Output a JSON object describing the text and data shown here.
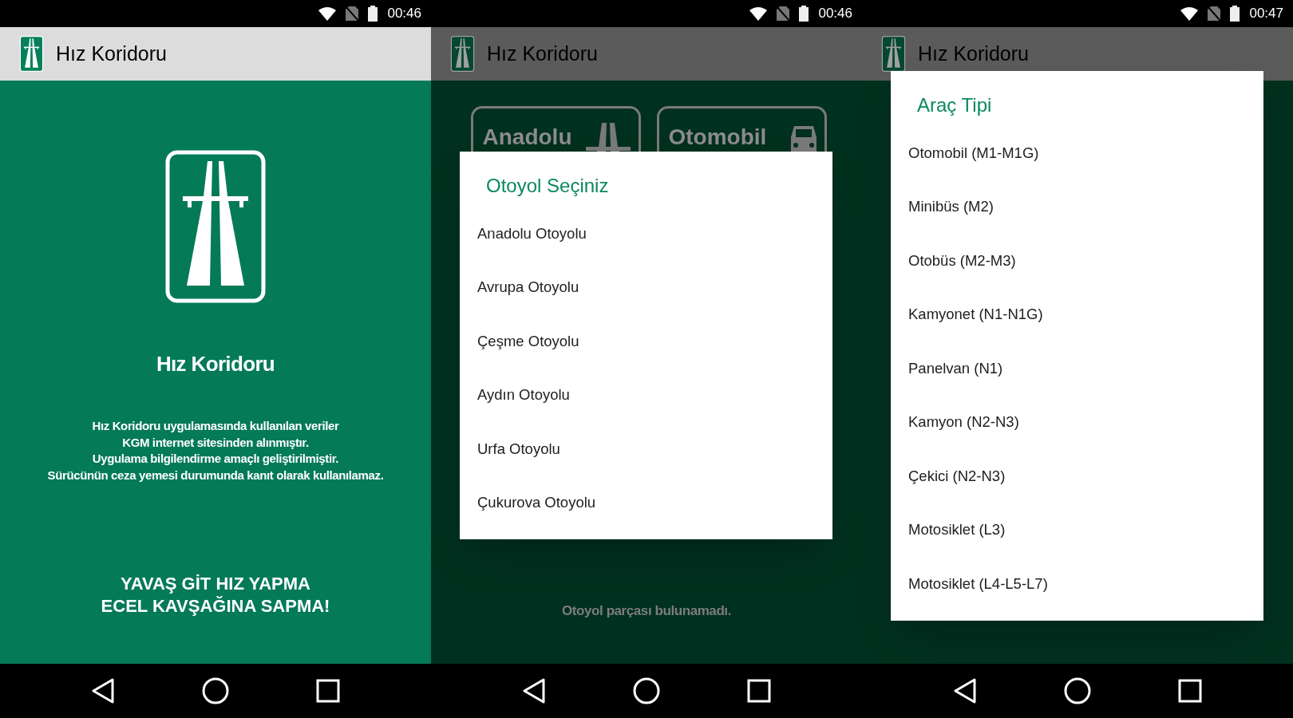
{
  "screens": [
    {
      "kind": "splash",
      "dimmed": false,
      "status_bar": {
        "time": "00:46"
      },
      "app_bar": {
        "title": "Hız Koridoru"
      },
      "splash": {
        "title": "Hız Koridoru",
        "disclaimer": [
          "Hız Koridoru uygulamasında kullanılan veriler",
          "KGM internet sitesinden alınmıştır.",
          "Uygulama bilgilendirme amaçlı geliştirilmiştir.",
          "Sürücünün ceza yemesi durumunda kanıt olarak kullanılamaz."
        ],
        "slogan": [
          "YAVAŞ GİT HIZ YAPMA",
          "ECEL KAVŞAĞINA SAPMA!"
        ]
      }
    },
    {
      "kind": "dialog",
      "dimmed": true,
      "status_bar": {
        "time": "00:46"
      },
      "app_bar": {
        "title": "Hız Koridoru"
      },
      "background": {
        "buttons": [
          {
            "label": "Anadolu",
            "kind": "road"
          },
          {
            "label": "Otomobil",
            "kind": "car"
          }
        ],
        "message": "Otoyol parçası bulunamadı."
      },
      "dialog": {
        "title": "Otoyol Seçiniz",
        "items": [
          "Anadolu Otoyolu",
          "Avrupa Otoyolu",
          "Çeşme Otoyolu",
          "Aydın Otoyolu",
          "Urfa Otoyolu",
          "Çukurova Otoyolu"
        ]
      }
    },
    {
      "kind": "dialog",
      "dimmed": true,
      "status_bar": {
        "time": "00:47"
      },
      "app_bar": {
        "title": "Hız Koridoru"
      },
      "dialog": {
        "title": "Araç Tipi",
        "items": [
          "Otomobil (M1-M1G)",
          "Minibüs (M2)",
          "Otobüs (M2-M3)",
          "Kamyonet (N1-N1G)",
          "Panelvan (N1)",
          "Kamyon (N2-N3)",
          "Çekici (N2-N3)",
          "Motosiklet (L3)",
          "Motosiklet (L4-L5-L7)"
        ]
      }
    }
  ]
}
